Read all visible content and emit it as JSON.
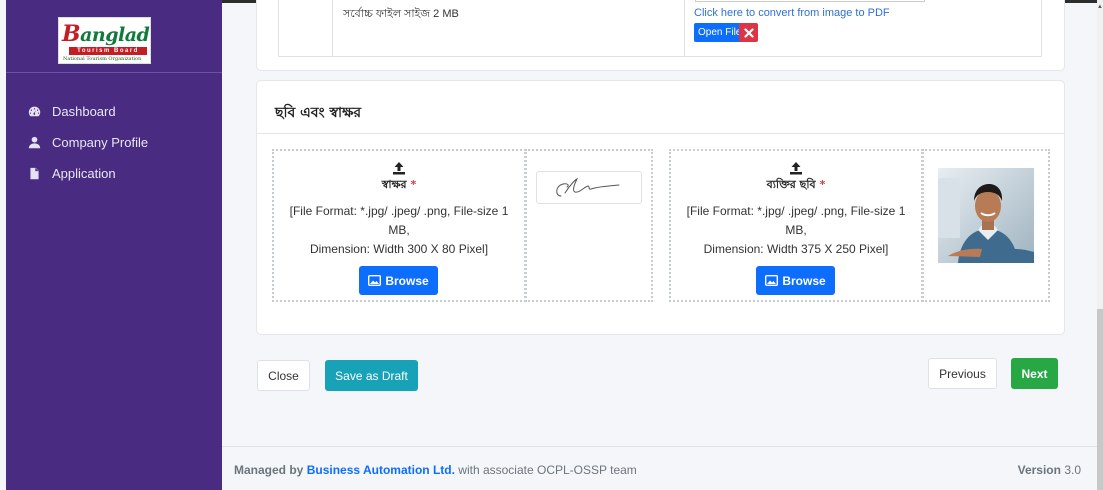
{
  "sidebar": {
    "logo": {
      "main": "Bangladesh",
      "band": "Tourism Board",
      "sub": "National Tourism Organization"
    },
    "items": [
      {
        "label": "Dashboard",
        "icon": "dashboard-icon"
      },
      {
        "label": "Company Profile",
        "icon": "user-icon"
      },
      {
        "label": "Application",
        "icon": "file-icon"
      }
    ]
  },
  "previous_section": {
    "size_note": "সর্বোচ্চ ফাইল সাইজ 2 MB",
    "convert_link": "Click here to convert from image to PDF",
    "open_file": "Open File"
  },
  "signature_section": {
    "title": "ছবি এবং স্বাক্ষর",
    "signature": {
      "label": "স্বাক্ষর",
      "required": "*",
      "format": "[File Format: *.jpg/ .jpeg/ .png, File-size 1 MB,",
      "dimension": "Dimension: Width 300 X 80 Pixel]",
      "browse": "Browse"
    },
    "photo": {
      "label": "ব্যক্তির ছবি",
      "required": "*",
      "format": "[File Format: *.jpg/ .jpeg/ .png, File-size 1 MB,",
      "dimension": "Dimension: Width 375 X 250 Pixel]",
      "browse": "Browse"
    }
  },
  "actions": {
    "close": "Close",
    "save_draft": "Save as Draft",
    "previous": "Previous",
    "next": "Next"
  },
  "footer": {
    "managed_by": "Managed by",
    "company": "Business Automation Ltd.",
    "rest": "with associate OCPL-OSSP team",
    "version_label": "Version",
    "version": "3.0"
  },
  "colors": {
    "sidebar": "#4a2b82",
    "primary": "#0d6efd",
    "info": "#17a2b8",
    "success": "#28a745",
    "danger": "#dc3545"
  }
}
